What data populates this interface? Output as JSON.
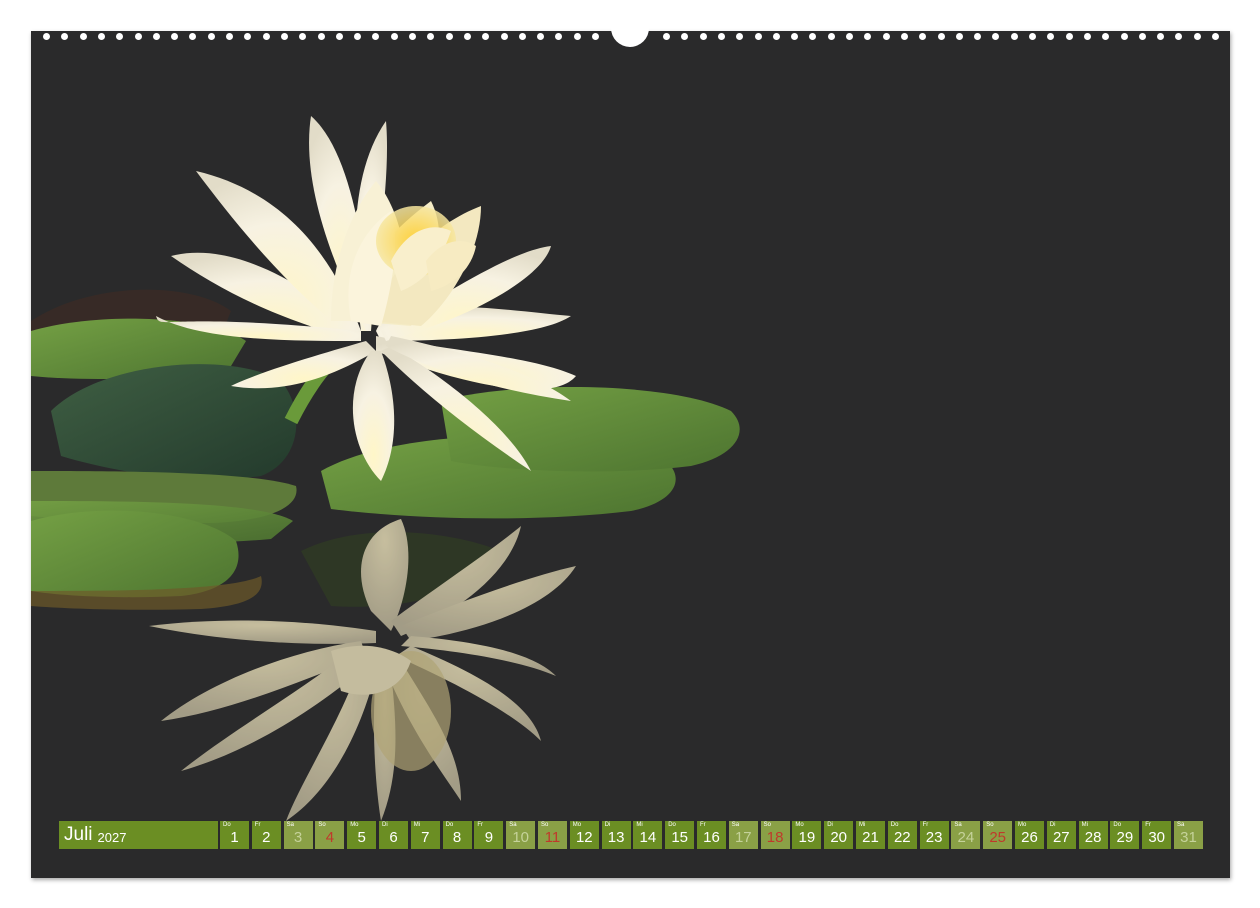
{
  "calendar": {
    "month": "Juli",
    "year": "2027",
    "days": [
      {
        "wd": "Do",
        "n": "1",
        "type": "work"
      },
      {
        "wd": "Fr",
        "n": "2",
        "type": "work"
      },
      {
        "wd": "Sa",
        "n": "3",
        "type": "weekend"
      },
      {
        "wd": "So",
        "n": "4",
        "type": "sunday"
      },
      {
        "wd": "Mo",
        "n": "5",
        "type": "work"
      },
      {
        "wd": "Di",
        "n": "6",
        "type": "work"
      },
      {
        "wd": "Mi",
        "n": "7",
        "type": "work"
      },
      {
        "wd": "Do",
        "n": "8",
        "type": "work"
      },
      {
        "wd": "Fr",
        "n": "9",
        "type": "work"
      },
      {
        "wd": "Sa",
        "n": "10",
        "type": "weekend"
      },
      {
        "wd": "So",
        "n": "11",
        "type": "sunday"
      },
      {
        "wd": "Mo",
        "n": "12",
        "type": "work"
      },
      {
        "wd": "Di",
        "n": "13",
        "type": "work"
      },
      {
        "wd": "Mi",
        "n": "14",
        "type": "work"
      },
      {
        "wd": "Do",
        "n": "15",
        "type": "work"
      },
      {
        "wd": "Fr",
        "n": "16",
        "type": "work"
      },
      {
        "wd": "Sa",
        "n": "17",
        "type": "weekend"
      },
      {
        "wd": "So",
        "n": "18",
        "type": "sunday"
      },
      {
        "wd": "Mo",
        "n": "19",
        "type": "work"
      },
      {
        "wd": "Di",
        "n": "20",
        "type": "work"
      },
      {
        "wd": "Mi",
        "n": "21",
        "type": "work"
      },
      {
        "wd": "Do",
        "n": "22",
        "type": "work"
      },
      {
        "wd": "Fr",
        "n": "23",
        "type": "work"
      },
      {
        "wd": "Sa",
        "n": "24",
        "type": "weekend"
      },
      {
        "wd": "So",
        "n": "25",
        "type": "sunday"
      },
      {
        "wd": "Mo",
        "n": "26",
        "type": "work"
      },
      {
        "wd": "Di",
        "n": "27",
        "type": "work"
      },
      {
        "wd": "Mi",
        "n": "28",
        "type": "work"
      },
      {
        "wd": "Do",
        "n": "29",
        "type": "work"
      },
      {
        "wd": "Fr",
        "n": "30",
        "type": "work"
      },
      {
        "wd": "Sa",
        "n": "31",
        "type": "weekend"
      }
    ]
  },
  "colors": {
    "background": "#2a2a2b",
    "calendar_green": "#6b8e23",
    "weekend_green": "#8aa046",
    "holiday_red": "#c0392b",
    "petal": "#f6f1dc",
    "leaf": "#5f8a3a"
  },
  "photo": {
    "subject": "water-lily-icon"
  }
}
